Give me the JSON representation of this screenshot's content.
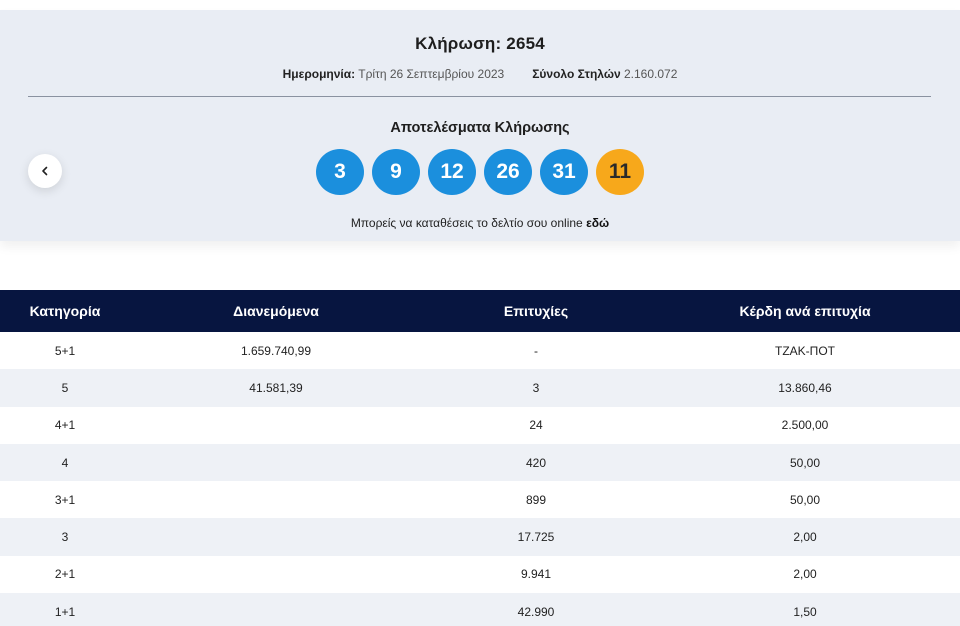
{
  "draw": {
    "title": "Κλήρωση: 2654",
    "date_label": "Ημερομηνία:",
    "date_value": "Τρίτη 26 Σεπτεμβρίου 2023",
    "columns_label": "Σύνολο Στηλών",
    "columns_value": "2.160.072",
    "results_title": "Αποτελέσματα Κλήρωσης",
    "numbers": [
      "3",
      "9",
      "12",
      "26",
      "31"
    ],
    "joker": "11",
    "online_text": "Μπορείς να καταθέσεις το δελτίο σου online",
    "online_link": "εδώ",
    "accent_blue": "#1b8fdd",
    "accent_orange": "#f7a81b"
  },
  "table": {
    "headers": [
      "Κατηγορία",
      "Διανεμόμενα",
      "Επιτυχίες",
      "Κέρδη ανά επιτυχία"
    ],
    "rows": [
      [
        "5+1",
        "1.659.740,99",
        "-",
        "ΤΖΑΚ-ΠΟΤ"
      ],
      [
        "5",
        "41.581,39",
        "3",
        "13.860,46"
      ],
      [
        "4+1",
        "",
        "24",
        "2.500,00"
      ],
      [
        "4",
        "",
        "420",
        "50,00"
      ],
      [
        "3+1",
        "",
        "899",
        "50,00"
      ],
      [
        "3",
        "",
        "17.725",
        "2,00"
      ],
      [
        "2+1",
        "",
        "9.941",
        "2,00"
      ],
      [
        "1+1",
        "",
        "42.990",
        "1,50"
      ]
    ],
    "header_color": "#071540"
  }
}
